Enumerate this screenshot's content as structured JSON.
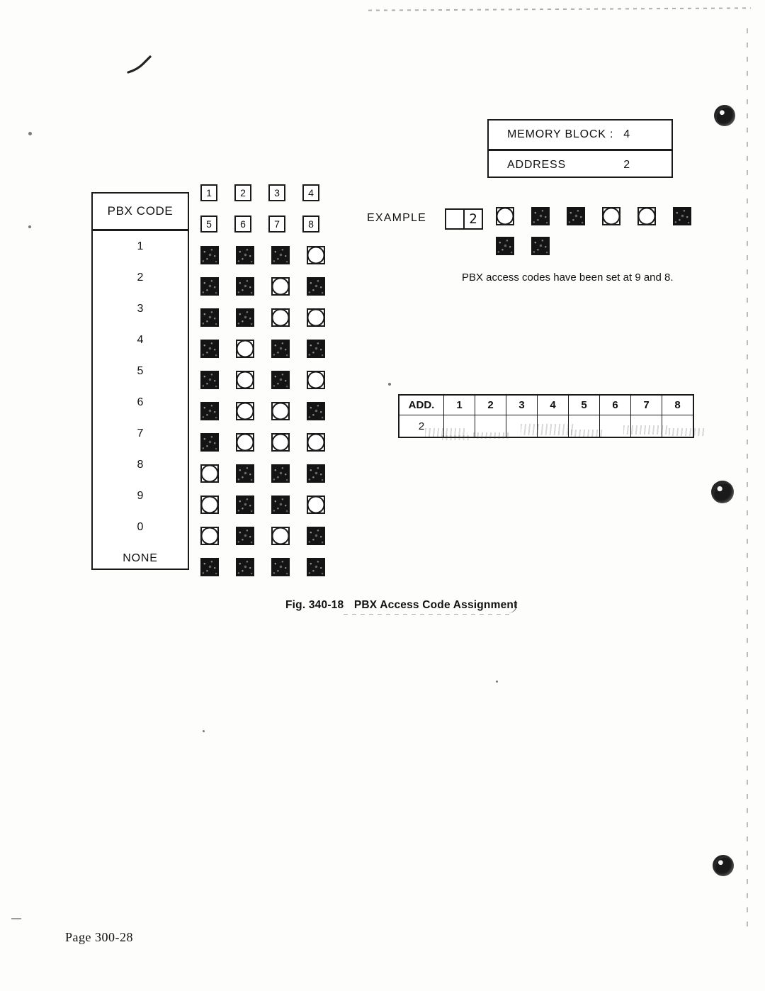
{
  "document": {
    "figure_caption_number": "Fig. 340-18",
    "figure_caption_title": "PBX Access Code Assignment",
    "page_footer": "Page  300-28"
  },
  "memory_block": {
    "block_label": "MEMORY BLOCK :",
    "block_value": "4",
    "address_label": "ADDRESS",
    "address_value": "2"
  },
  "switch_header": {
    "row1": [
      "1",
      "2",
      "3",
      "4"
    ],
    "row2": [
      "5",
      "6",
      "7",
      "8"
    ]
  },
  "pbx_code_table": {
    "header": "PBX CODE",
    "rows": [
      {
        "code": "1",
        "switches": [
          "on",
          "on",
          "on",
          "off"
        ]
      },
      {
        "code": "2",
        "switches": [
          "on",
          "on",
          "off",
          "on"
        ]
      },
      {
        "code": "3",
        "switches": [
          "on",
          "on",
          "off",
          "off"
        ]
      },
      {
        "code": "4",
        "switches": [
          "on",
          "off",
          "on",
          "on"
        ]
      },
      {
        "code": "5",
        "switches": [
          "on",
          "off",
          "on",
          "off"
        ]
      },
      {
        "code": "6",
        "switches": [
          "on",
          "off",
          "off",
          "on"
        ]
      },
      {
        "code": "7",
        "switches": [
          "on",
          "off",
          "off",
          "off"
        ]
      },
      {
        "code": "8",
        "switches": [
          "off",
          "on",
          "on",
          "on"
        ]
      },
      {
        "code": "9",
        "switches": [
          "off",
          "on",
          "on",
          "off"
        ]
      },
      {
        "code": "0",
        "switches": [
          "off",
          "on",
          "off",
          "on"
        ]
      },
      {
        "code": "NONE",
        "switches": [
          "on",
          "on",
          "on",
          "on"
        ]
      }
    ]
  },
  "example": {
    "label": "EXAMPLE",
    "display_digit": "2",
    "switches_row1": [
      "off",
      "on",
      "on",
      "off",
      "off",
      "on"
    ],
    "switches_row2": [
      "on",
      "on"
    ],
    "note": "PBX access codes have been set at 9 and 8."
  },
  "address_table": {
    "label": "ADD.",
    "columns": [
      "1",
      "2",
      "3",
      "4",
      "5",
      "6",
      "7",
      "8"
    ],
    "rows": [
      {
        "address": "2",
        "cells": [
          "",
          "",
          "",
          "",
          "",
          "",
          "",
          ""
        ]
      }
    ]
  }
}
